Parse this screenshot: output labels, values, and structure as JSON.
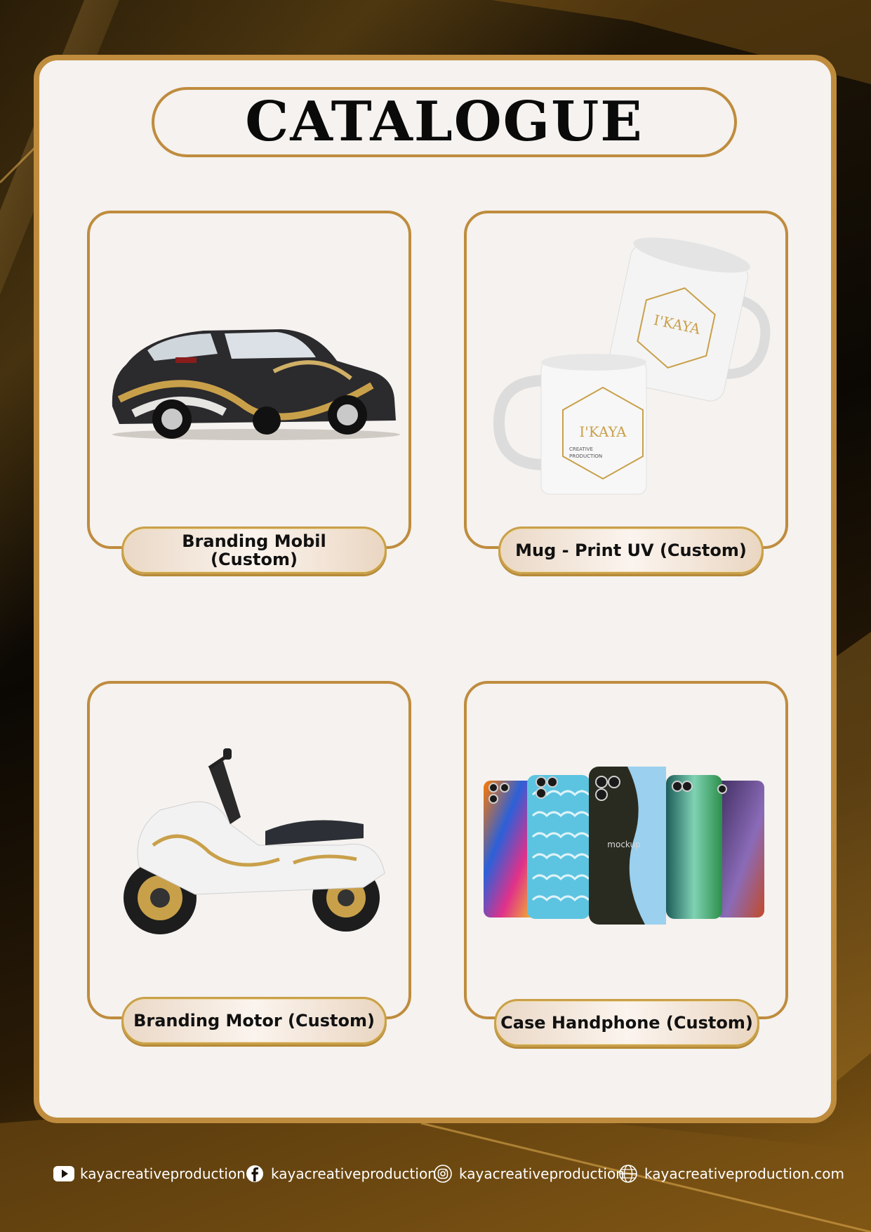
{
  "title": "CATALOGUE",
  "colors": {
    "gold": "#bf8c3e",
    "panel": "#f5f2ef",
    "background": "#120d05"
  },
  "products": [
    {
      "label": "Branding Mobil (Custom)",
      "icon": "car-image"
    },
    {
      "label": "Mug - Print UV (Custom)",
      "icon": "mug-image"
    },
    {
      "label": "Branding Motor (Custom)",
      "icon": "scooter-image"
    },
    {
      "label": "Case Handphone (Custom)",
      "icon": "phone-case-image"
    }
  ],
  "mug_brand": {
    "name": "I'KAYA",
    "line1": "CREATIVE",
    "line2": "PRODUCTION"
  },
  "phone_watermark": "mockup",
  "footer": {
    "youtube": {
      "icon": "youtube-icon",
      "text": "kayacreativeproduction"
    },
    "facebook": {
      "icon": "facebook-icon",
      "text": "kayacreativeproduction"
    },
    "instagram": {
      "icon": "instagram-icon",
      "text": "kayacreativeproduction"
    },
    "website": {
      "icon": "globe-icon",
      "text": "kayacreativeproduction.com"
    }
  }
}
